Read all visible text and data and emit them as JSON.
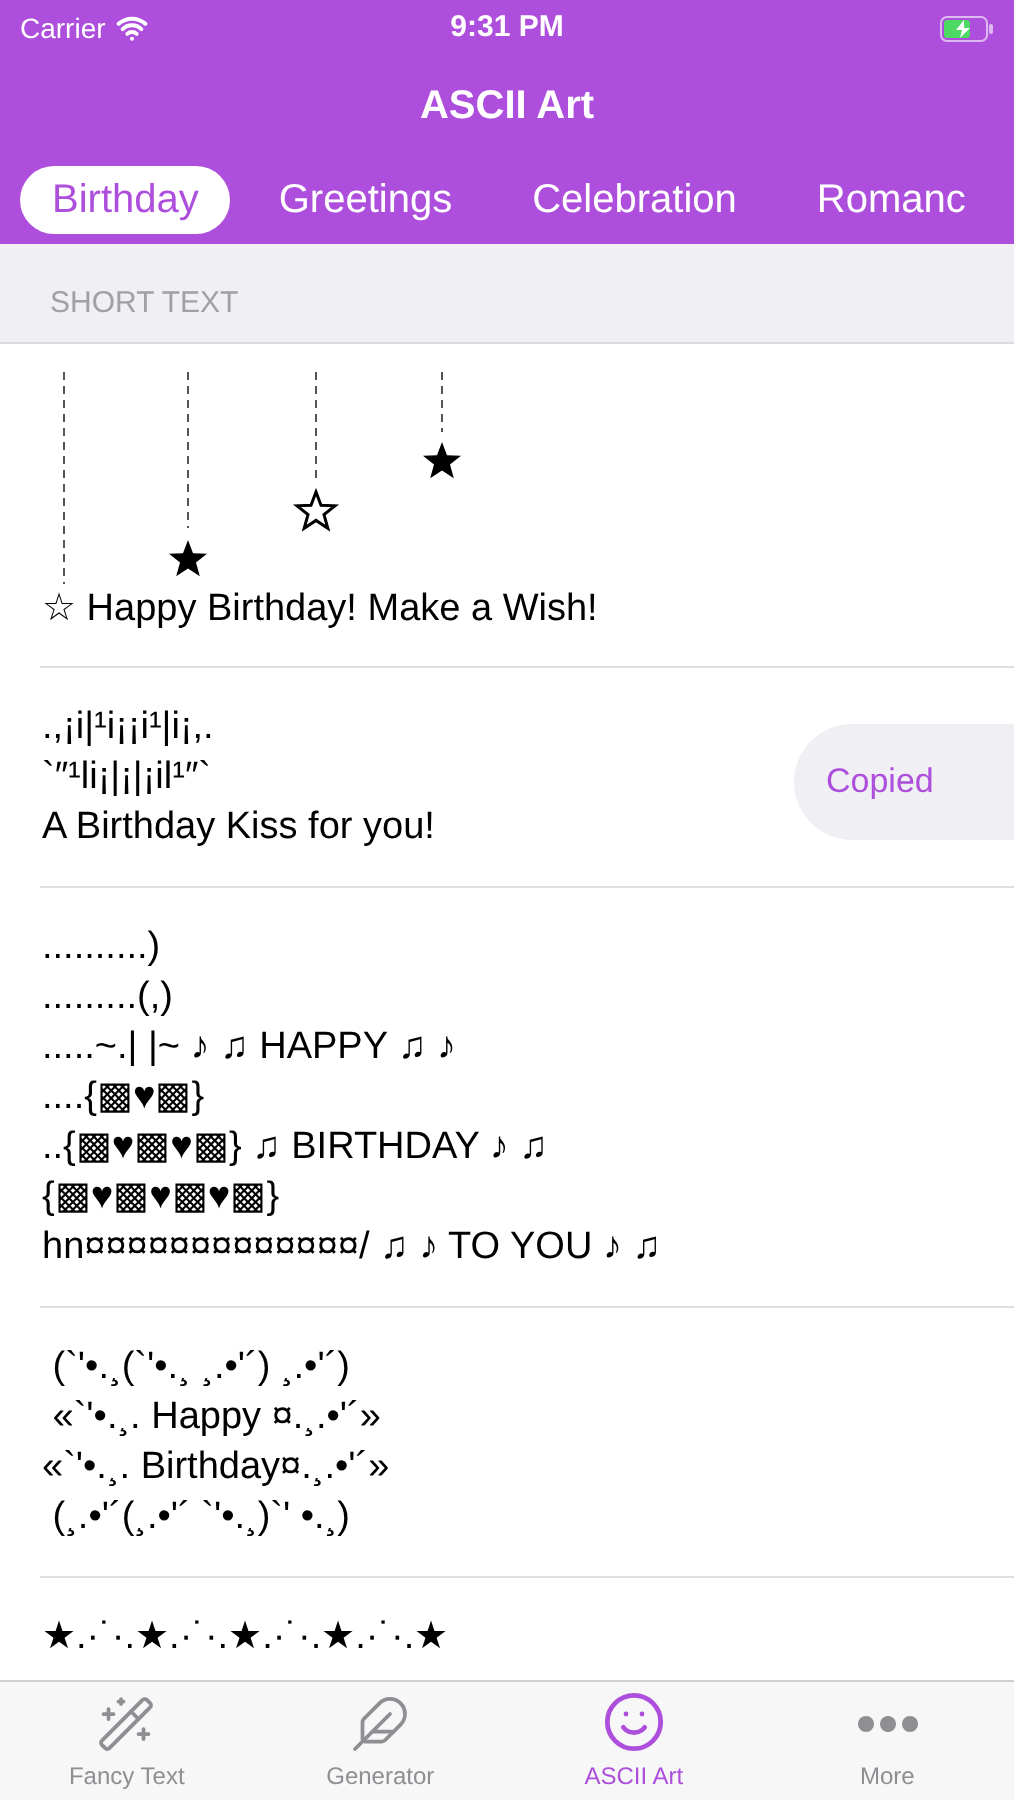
{
  "status_bar": {
    "carrier": "Carrier",
    "time": "9:31 PM"
  },
  "title": "ASCII Art",
  "tabs": [
    {
      "label": "Birthday",
      "selected": true
    },
    {
      "label": "Greetings",
      "selected": false
    },
    {
      "label": "Celebration",
      "selected": false
    },
    {
      "label": "Romanc",
      "selected": false
    }
  ],
  "section_header": "SHORT TEXT",
  "items": [
    {
      "kind": "hanging-stars",
      "lines": [
        "☆ Happy Birthday! Make a Wish!"
      ]
    },
    {
      "kind": "text",
      "lines": [
        ".,¡i|¹i¡¡i¹|i¡,.",
        "`″¹li¡|¡|¡il¹″`",
        "A Birthday Kiss for you!"
      ],
      "swipe_action": "Copied"
    },
    {
      "kind": "text",
      "lines": [
        "..........)",
        ".........(,)",
        ".....~.| |~ ♪ ♫ HAPPY ♫ ♪",
        "....{▩♥▩}",
        "..{▩♥▩♥▩} ♫ BIRTHDAY ♪ ♫",
        "{▩♥▩♥▩♥▩}",
        "hn¤¤¤¤¤¤¤¤¤¤¤¤¤/ ♫ ♪ TO YOU ♪ ♫"
      ]
    },
    {
      "kind": "text",
      "lines": [
        " (`'•.¸(`'•.¸ ¸.•'´) ¸.•'´)",
        " «`'•.¸. Happy ¤.¸.•'´»",
        "«`'•.¸. Birthday¤.¸.•'´»",
        " (¸.•'´(¸.•'´ `'•.¸)`' •.¸)"
      ]
    },
    {
      "kind": "text",
      "lines": [
        "★.·˙·.★.·˙·.★.·˙·.★.·˙·.★"
      ]
    }
  ],
  "bottom_tabs": [
    {
      "label": "Fancy Text",
      "kind": "wand",
      "selected": false
    },
    {
      "label": "Generator",
      "kind": "feather",
      "selected": false
    },
    {
      "label": "ASCII Art",
      "kind": "smile",
      "selected": true
    },
    {
      "label": "More",
      "kind": "more",
      "selected": false
    }
  ]
}
